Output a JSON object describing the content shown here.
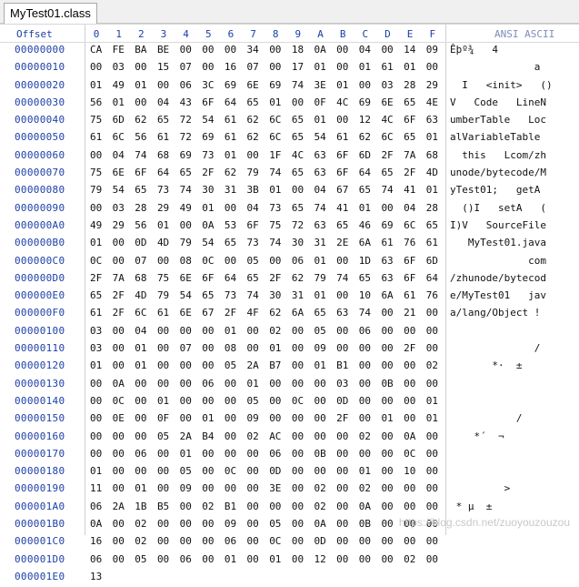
{
  "tab": {
    "label": "MyTest01.class"
  },
  "header": {
    "offset_label": "Offset",
    "columns": [
      "0",
      "1",
      "2",
      "3",
      "4",
      "5",
      "6",
      "7",
      "8",
      "9",
      "A",
      "B",
      "C",
      "D",
      "E",
      "F"
    ],
    "ascii_label": "ANSI ASCII"
  },
  "rows": [
    {
      "offset": "00000000",
      "hex": "CA FE BA BE 00 00 00 34 00 18 0A 00 04 00 14 09",
      "ascii": "Êþº¾   4"
    },
    {
      "offset": "00000010",
      "hex": "00 03 00 15 07 00 16 07 00 17 01 00 01 61 01 00",
      "ascii": "              a"
    },
    {
      "offset": "00000020",
      "hex": "01 49 01 00 06 3C 69 6E 69 74 3E 01 00 03 28 29",
      "ascii": "  I   <init>   ()"
    },
    {
      "offset": "00000030",
      "hex": "56 01 00 04 43 6F 64 65 01 00 0F 4C 69 6E 65 4E",
      "ascii": "V   Code   LineN"
    },
    {
      "offset": "00000040",
      "hex": "75 6D 62 65 72 54 61 62 6C 65 01 00 12 4C 6F 63",
      "ascii": "umberTable   Loc"
    },
    {
      "offset": "00000050",
      "hex": "61 6C 56 61 72 69 61 62 6C 65 54 61 62 6C 65 01",
      "ascii": "alVariableTable"
    },
    {
      "offset": "00000060",
      "hex": "00 04 74 68 69 73 01 00 1F 4C 63 6F 6D 2F 7A 68",
      "ascii": "  this   Lcom/zh"
    },
    {
      "offset": "00000070",
      "hex": "75 6E 6F 64 65 2F 62 79 74 65 63 6F 64 65 2F 4D",
      "ascii": "unode/bytecode/M"
    },
    {
      "offset": "00000080",
      "hex": "79 54 65 73 74 30 31 3B 01 00 04 67 65 74 41 01",
      "ascii": "yTest01;   getA"
    },
    {
      "offset": "00000090",
      "hex": "00 03 28 29 49 01 00 04 73 65 74 41 01 00 04 28",
      "ascii": "  ()I   setA   ("
    },
    {
      "offset": "000000A0",
      "hex": "49 29 56 01 00 0A 53 6F 75 72 63 65 46 69 6C 65",
      "ascii": "I)V   SourceFile"
    },
    {
      "offset": "000000B0",
      "hex": "01 00 0D 4D 79 54 65 73 74 30 31 2E 6A 61 76 61",
      "ascii": "   MyTest01.java"
    },
    {
      "offset": "000000C0",
      "hex": "0C 00 07 00 08 0C 00 05 00 06 01 00 1D 63 6F 6D",
      "ascii": "             com"
    },
    {
      "offset": "000000D0",
      "hex": "2F 7A 68 75 6E 6F 64 65 2F 62 79 74 65 63 6F 64",
      "ascii": "/zhunode/bytecod"
    },
    {
      "offset": "000000E0",
      "hex": "65 2F 4D 79 54 65 73 74 30 31 01 00 10 6A 61 76",
      "ascii": "e/MyTest01   jav"
    },
    {
      "offset": "000000F0",
      "hex": "61 2F 6C 61 6E 67 2F 4F 62 6A 65 63 74 00 21 00",
      "ascii": "a/lang/Object !"
    },
    {
      "offset": "00000100",
      "hex": "03 00 04 00 00 00 01 00 02 00 05 00 06 00 00 00",
      "ascii": ""
    },
    {
      "offset": "00000110",
      "hex": "03 00 01 00 07 00 08 00 01 00 09 00 00 00 2F 00",
      "ascii": "              /"
    },
    {
      "offset": "00000120",
      "hex": "01 00 01 00 00 00 05 2A B7 00 01 B1 00 00 00 02",
      "ascii": "       *·  ±"
    },
    {
      "offset": "00000130",
      "hex": "00 0A 00 00 00 06 00 01 00 00 00 03 00 0B 00 00",
      "ascii": ""
    },
    {
      "offset": "00000140",
      "hex": "00 0C 00 01 00 00 00 05 00 0C 00 0D 00 00 00 01",
      "ascii": ""
    },
    {
      "offset": "00000150",
      "hex": "00 0E 00 0F 00 01 00 09 00 00 00 2F 00 01 00 01",
      "ascii": "           /"
    },
    {
      "offset": "00000160",
      "hex": "00 00 00 05 2A B4 00 02 AC 00 00 00 02 00 0A 00",
      "ascii": "    *´  ¬"
    },
    {
      "offset": "00000170",
      "hex": "00 00 06 00 01 00 00 00 06 00 0B 00 00 00 0C 00",
      "ascii": ""
    },
    {
      "offset": "00000180",
      "hex": "01 00 00 00 05 00 0C 00 0D 00 00 00 01 00 10 00",
      "ascii": ""
    },
    {
      "offset": "00000190",
      "hex": "11 00 01 00 09 00 00 00 3E 00 02 00 02 00 00 00",
      "ascii": "         >"
    },
    {
      "offset": "000001A0",
      "hex": "06 2A 1B B5 00 02 B1 00 00 00 02 00 0A 00 00 00",
      "ascii": " * µ  ±"
    },
    {
      "offset": "000001B0",
      "hex": "0A 00 02 00 00 00 09 00 05 00 0A 00 0B 00 00 00",
      "ascii": ""
    },
    {
      "offset": "000001C0",
      "hex": "16 00 02 00 00 00 06 00 0C 00 0D 00 00 00 00 00",
      "ascii": ""
    },
    {
      "offset": "000001D0",
      "hex": "06 00 05 00 06 00 01 00 01 00 12 00 00 00 02 00",
      "ascii": ""
    },
    {
      "offset": "000001E0",
      "hex": "13",
      "ascii": ""
    }
  ],
  "watermark": "https://blog.csdn.net/zuoyouzouzou"
}
